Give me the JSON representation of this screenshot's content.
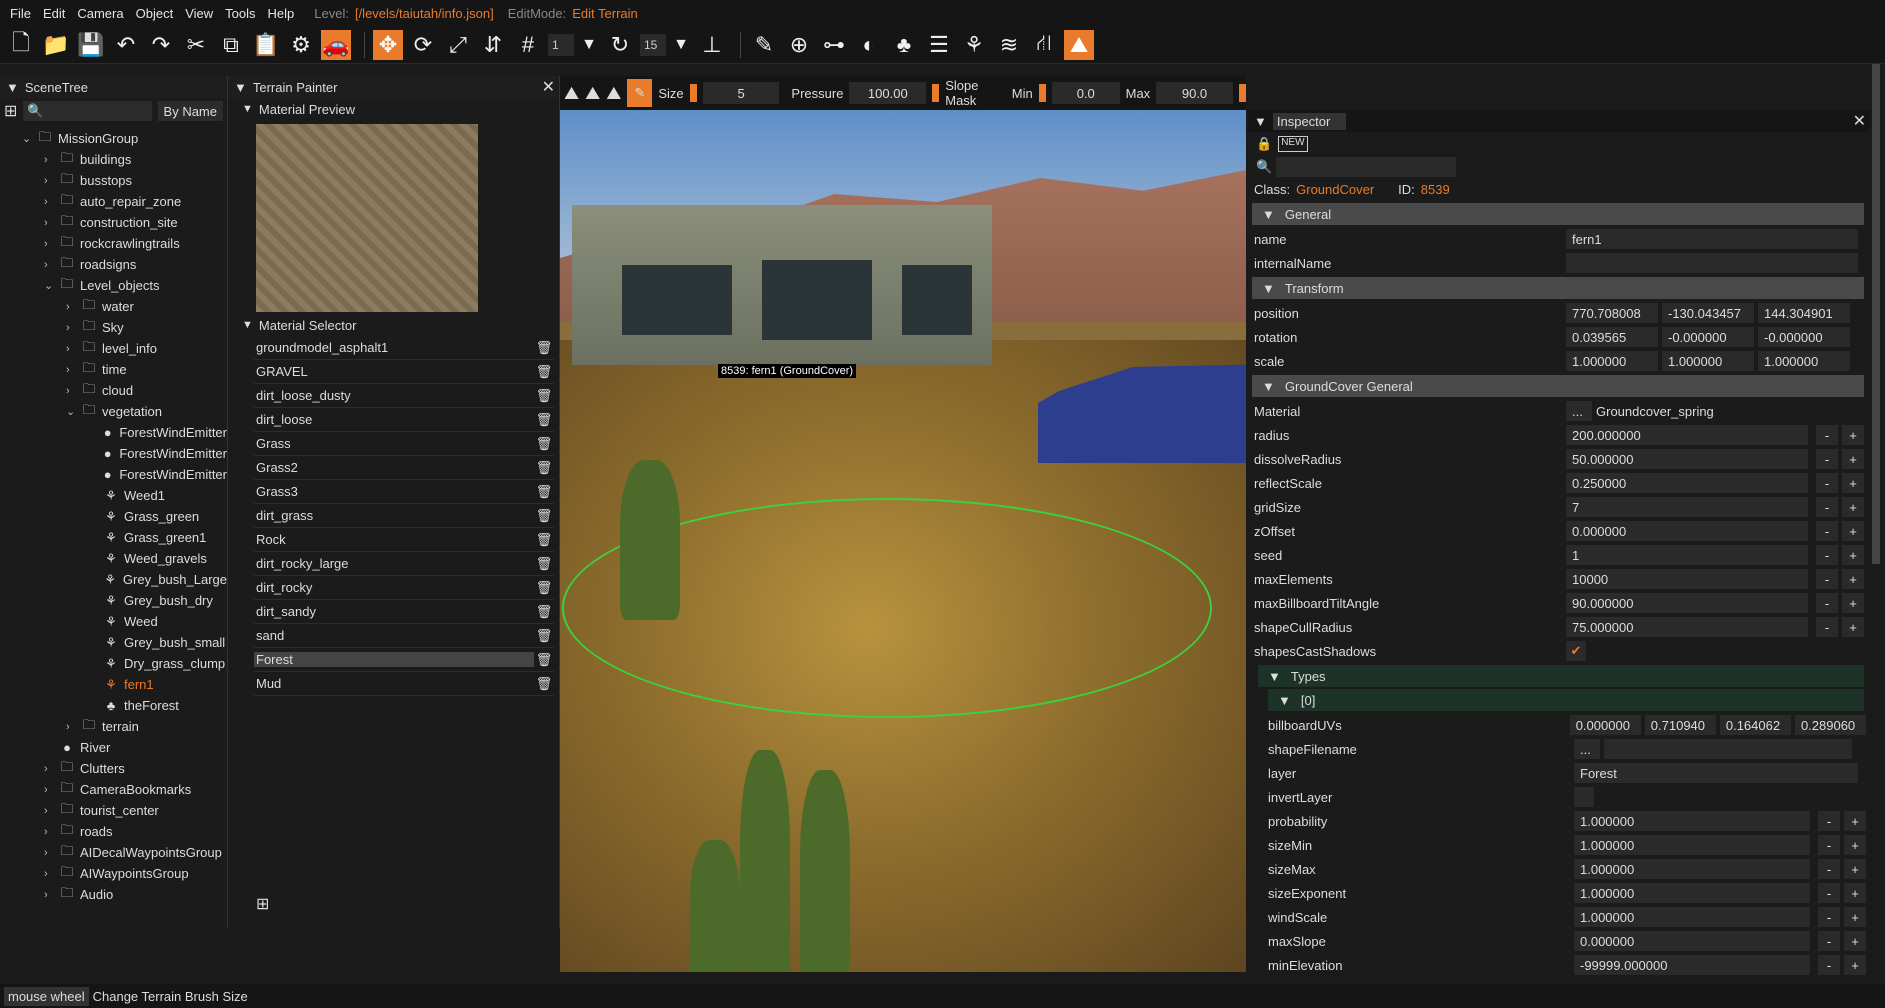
{
  "menu": {
    "items": [
      "File",
      "Edit",
      "Camera",
      "Object",
      "View",
      "Tools",
      "Help"
    ],
    "level_label": "Level:",
    "level_value": "[/levels/taiutah/info.json]",
    "editmode_label": "EditMode:",
    "editmode_value": "Edit Terrain"
  },
  "toolbar": {
    "snap_value1": "1",
    "snap_value2": "15",
    "icons": [
      "new-file",
      "open-folder",
      "save",
      "undo",
      "redo",
      "cut",
      "copy",
      "paste",
      "settings",
      "vehicle",
      "move",
      "rotate",
      "scale",
      "world-local",
      "grid-snap",
      "angle-snap",
      "camera-snap",
      "pencil",
      "add",
      "road",
      "shape",
      "forest",
      "layers",
      "decal",
      "river",
      "road-tool",
      "terrain-tool"
    ]
  },
  "brush": {
    "size_label": "Size",
    "size_value": "5",
    "pressure_label": "Pressure",
    "pressure_value": "100.00",
    "slope_label": "Slope Mask",
    "min_label": "Min",
    "min_value": "0.0",
    "max_label": "Max",
    "max_value": "90.0"
  },
  "scenetree": {
    "title": "SceneTree",
    "sort_btn": "By Name",
    "nodes": [
      {
        "label": "MissionGroup",
        "depth": 0,
        "type": "folder",
        "open": true
      },
      {
        "label": "buildings",
        "depth": 1,
        "type": "folder"
      },
      {
        "label": "busstops",
        "depth": 1,
        "type": "folder"
      },
      {
        "label": "auto_repair_zone",
        "depth": 1,
        "type": "folder"
      },
      {
        "label": "construction_site",
        "depth": 1,
        "type": "folder"
      },
      {
        "label": "rockcrawlingtrails",
        "depth": 1,
        "type": "folder"
      },
      {
        "label": "roadsigns",
        "depth": 1,
        "type": "folder"
      },
      {
        "label": "Level_objects",
        "depth": 1,
        "type": "folder",
        "open": true
      },
      {
        "label": "water",
        "depth": 2,
        "type": "folder"
      },
      {
        "label": "Sky",
        "depth": 2,
        "type": "folder"
      },
      {
        "label": "level_info",
        "depth": 2,
        "type": "folder"
      },
      {
        "label": "time",
        "depth": 2,
        "type": "folder"
      },
      {
        "label": "cloud",
        "depth": 2,
        "type": "folder"
      },
      {
        "label": "vegetation",
        "depth": 2,
        "type": "folder",
        "open": true
      },
      {
        "label": "ForestWindEmitter",
        "depth": 3,
        "type": "circle"
      },
      {
        "label": "ForestWindEmitter",
        "depth": 3,
        "type": "circle"
      },
      {
        "label": "ForestWindEmitter",
        "depth": 3,
        "type": "circle"
      },
      {
        "label": "Weed1",
        "depth": 3,
        "type": "plant"
      },
      {
        "label": "Grass_green",
        "depth": 3,
        "type": "plant"
      },
      {
        "label": "Grass_green1",
        "depth": 3,
        "type": "plant"
      },
      {
        "label": "Weed_gravels",
        "depth": 3,
        "type": "plant"
      },
      {
        "label": "Grey_bush_Large",
        "depth": 3,
        "type": "plant"
      },
      {
        "label": "Grey_bush_dry",
        "depth": 3,
        "type": "plant"
      },
      {
        "label": "Weed",
        "depth": 3,
        "type": "plant"
      },
      {
        "label": "Grey_bush_small",
        "depth": 3,
        "type": "plant"
      },
      {
        "label": "Dry_grass_clump",
        "depth": 3,
        "type": "plant"
      },
      {
        "label": "fern1",
        "depth": 3,
        "type": "plant",
        "selected": true
      },
      {
        "label": "theForest",
        "depth": 3,
        "type": "tree"
      },
      {
        "label": "terrain",
        "depth": 2,
        "type": "folder"
      },
      {
        "label": "River",
        "depth": 1,
        "type": "circle"
      },
      {
        "label": "Clutters",
        "depth": 1,
        "type": "folder"
      },
      {
        "label": "CameraBookmarks",
        "depth": 1,
        "type": "folder"
      },
      {
        "label": "tourist_center",
        "depth": 1,
        "type": "folder"
      },
      {
        "label": "roads",
        "depth": 1,
        "type": "folder"
      },
      {
        "label": "AIDecalWaypointsGroup",
        "depth": 1,
        "type": "folder"
      },
      {
        "label": "AIWaypointsGroup",
        "depth": 1,
        "type": "folder"
      },
      {
        "label": "Audio",
        "depth": 1,
        "type": "folder"
      }
    ]
  },
  "terrain": {
    "title": "Terrain Painter",
    "preview_label": "Material Preview",
    "selector_label": "Material Selector",
    "materials": [
      "groundmodel_asphalt1",
      "GRAVEL",
      "dirt_loose_dusty",
      "dirt_loose",
      "Grass",
      "Grass2",
      "Grass3",
      "dirt_grass",
      "Rock",
      "dirt_rocky_large",
      "dirt_rocky",
      "dirt_sandy",
      "sand",
      "Forest",
      "Mud"
    ],
    "selected": "Forest"
  },
  "viewport": {
    "object_label": "8539: fern1 (GroundCover)"
  },
  "inspector": {
    "title": "Inspector",
    "class_label": "Class:",
    "class_value": "GroundCover",
    "id_label": "ID:",
    "id_value": "8539",
    "general": {
      "title": "General",
      "name_label": "name",
      "name_value": "fern1",
      "internal_label": "internalName",
      "internal_value": ""
    },
    "transform": {
      "title": "Transform",
      "rows": [
        {
          "k": "position",
          "v": [
            "770.708008",
            "-130.043457",
            "144.304901"
          ]
        },
        {
          "k": "rotation",
          "v": [
            "0.039565",
            "-0.000000",
            "-0.000000"
          ]
        },
        {
          "k": "scale",
          "v": [
            "1.000000",
            "1.000000",
            "1.000000"
          ]
        }
      ]
    },
    "gc": {
      "title": "GroundCover General",
      "material_label": "Material",
      "material_btn": "...",
      "material_value": "Groundcover_spring",
      "rows": [
        {
          "k": "radius",
          "v": "200.000000"
        },
        {
          "k": "dissolveRadius",
          "v": "50.000000"
        },
        {
          "k": "reflectScale",
          "v": "0.250000"
        },
        {
          "k": "gridSize",
          "v": "7"
        },
        {
          "k": "zOffset",
          "v": "0.000000"
        },
        {
          "k": "seed",
          "v": "1"
        },
        {
          "k": "maxElements",
          "v": "10000"
        },
        {
          "k": "maxBillboardTiltAngle",
          "v": "90.000000"
        },
        {
          "k": "shapeCullRadius",
          "v": "75.000000"
        }
      ],
      "shadows_label": "shapesCastShadows"
    },
    "types": {
      "title": "Types",
      "index": "[0]",
      "billboard_label": "billboardUVs",
      "billboard_values": [
        "0.000000",
        "0.710940",
        "0.164062",
        "0.289060"
      ],
      "shape_label": "shapeFilename",
      "shape_btn": "...",
      "layer_label": "layer",
      "layer_value": "Forest",
      "invert_label": "invertLayer",
      "rows": [
        {
          "k": "probability",
          "v": "1.000000"
        },
        {
          "k": "sizeMin",
          "v": "1.000000"
        },
        {
          "k": "sizeMax",
          "v": "1.000000"
        },
        {
          "k": "sizeExponent",
          "v": "1.000000"
        },
        {
          "k": "windScale",
          "v": "1.000000"
        },
        {
          "k": "maxSlope",
          "v": "0.000000"
        },
        {
          "k": "minElevation",
          "v": "-99999.000000"
        }
      ]
    }
  },
  "status": {
    "key": "mouse wheel",
    "text": "Change Terrain Brush Size"
  }
}
